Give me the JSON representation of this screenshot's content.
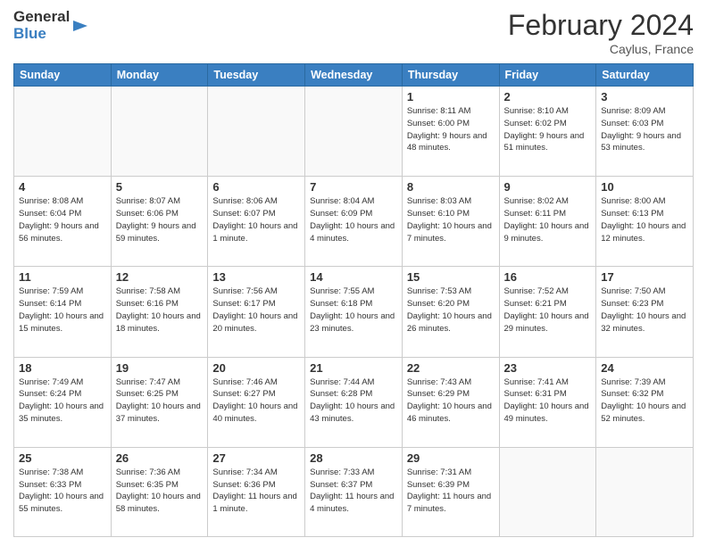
{
  "header": {
    "logo_general": "General",
    "logo_blue": "Blue",
    "month_title": "February 2024",
    "location": "Caylus, France"
  },
  "days_of_week": [
    "Sunday",
    "Monday",
    "Tuesday",
    "Wednesday",
    "Thursday",
    "Friday",
    "Saturday"
  ],
  "weeks": [
    [
      {
        "day": "",
        "info": ""
      },
      {
        "day": "",
        "info": ""
      },
      {
        "day": "",
        "info": ""
      },
      {
        "day": "",
        "info": ""
      },
      {
        "day": "1",
        "info": "Sunrise: 8:11 AM\nSunset: 6:00 PM\nDaylight: 9 hours and 48 minutes."
      },
      {
        "day": "2",
        "info": "Sunrise: 8:10 AM\nSunset: 6:02 PM\nDaylight: 9 hours and 51 minutes."
      },
      {
        "day": "3",
        "info": "Sunrise: 8:09 AM\nSunset: 6:03 PM\nDaylight: 9 hours and 53 minutes."
      }
    ],
    [
      {
        "day": "4",
        "info": "Sunrise: 8:08 AM\nSunset: 6:04 PM\nDaylight: 9 hours and 56 minutes."
      },
      {
        "day": "5",
        "info": "Sunrise: 8:07 AM\nSunset: 6:06 PM\nDaylight: 9 hours and 59 minutes."
      },
      {
        "day": "6",
        "info": "Sunrise: 8:06 AM\nSunset: 6:07 PM\nDaylight: 10 hours and 1 minute."
      },
      {
        "day": "7",
        "info": "Sunrise: 8:04 AM\nSunset: 6:09 PM\nDaylight: 10 hours and 4 minutes."
      },
      {
        "day": "8",
        "info": "Sunrise: 8:03 AM\nSunset: 6:10 PM\nDaylight: 10 hours and 7 minutes."
      },
      {
        "day": "9",
        "info": "Sunrise: 8:02 AM\nSunset: 6:11 PM\nDaylight: 10 hours and 9 minutes."
      },
      {
        "day": "10",
        "info": "Sunrise: 8:00 AM\nSunset: 6:13 PM\nDaylight: 10 hours and 12 minutes."
      }
    ],
    [
      {
        "day": "11",
        "info": "Sunrise: 7:59 AM\nSunset: 6:14 PM\nDaylight: 10 hours and 15 minutes."
      },
      {
        "day": "12",
        "info": "Sunrise: 7:58 AM\nSunset: 6:16 PM\nDaylight: 10 hours and 18 minutes."
      },
      {
        "day": "13",
        "info": "Sunrise: 7:56 AM\nSunset: 6:17 PM\nDaylight: 10 hours and 20 minutes."
      },
      {
        "day": "14",
        "info": "Sunrise: 7:55 AM\nSunset: 6:18 PM\nDaylight: 10 hours and 23 minutes."
      },
      {
        "day": "15",
        "info": "Sunrise: 7:53 AM\nSunset: 6:20 PM\nDaylight: 10 hours and 26 minutes."
      },
      {
        "day": "16",
        "info": "Sunrise: 7:52 AM\nSunset: 6:21 PM\nDaylight: 10 hours and 29 minutes."
      },
      {
        "day": "17",
        "info": "Sunrise: 7:50 AM\nSunset: 6:23 PM\nDaylight: 10 hours and 32 minutes."
      }
    ],
    [
      {
        "day": "18",
        "info": "Sunrise: 7:49 AM\nSunset: 6:24 PM\nDaylight: 10 hours and 35 minutes."
      },
      {
        "day": "19",
        "info": "Sunrise: 7:47 AM\nSunset: 6:25 PM\nDaylight: 10 hours and 37 minutes."
      },
      {
        "day": "20",
        "info": "Sunrise: 7:46 AM\nSunset: 6:27 PM\nDaylight: 10 hours and 40 minutes."
      },
      {
        "day": "21",
        "info": "Sunrise: 7:44 AM\nSunset: 6:28 PM\nDaylight: 10 hours and 43 minutes."
      },
      {
        "day": "22",
        "info": "Sunrise: 7:43 AM\nSunset: 6:29 PM\nDaylight: 10 hours and 46 minutes."
      },
      {
        "day": "23",
        "info": "Sunrise: 7:41 AM\nSunset: 6:31 PM\nDaylight: 10 hours and 49 minutes."
      },
      {
        "day": "24",
        "info": "Sunrise: 7:39 AM\nSunset: 6:32 PM\nDaylight: 10 hours and 52 minutes."
      }
    ],
    [
      {
        "day": "25",
        "info": "Sunrise: 7:38 AM\nSunset: 6:33 PM\nDaylight: 10 hours and 55 minutes."
      },
      {
        "day": "26",
        "info": "Sunrise: 7:36 AM\nSunset: 6:35 PM\nDaylight: 10 hours and 58 minutes."
      },
      {
        "day": "27",
        "info": "Sunrise: 7:34 AM\nSunset: 6:36 PM\nDaylight: 11 hours and 1 minute."
      },
      {
        "day": "28",
        "info": "Sunrise: 7:33 AM\nSunset: 6:37 PM\nDaylight: 11 hours and 4 minutes."
      },
      {
        "day": "29",
        "info": "Sunrise: 7:31 AM\nSunset: 6:39 PM\nDaylight: 11 hours and 7 minutes."
      },
      {
        "day": "",
        "info": ""
      },
      {
        "day": "",
        "info": ""
      }
    ]
  ]
}
